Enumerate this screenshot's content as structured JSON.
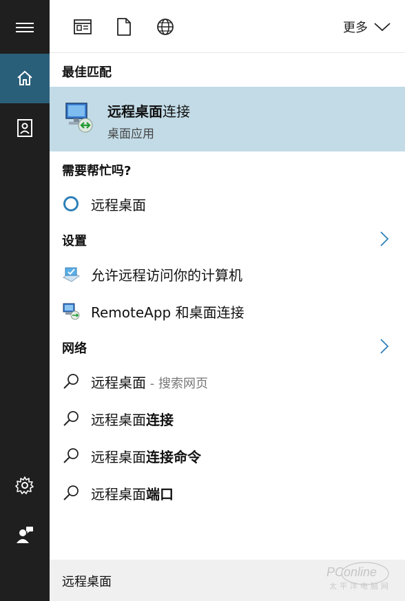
{
  "top_bar": {
    "more_label": "更多"
  },
  "best_match": {
    "heading": "最佳匹配",
    "title_bold": "远程桌面",
    "title_rest": "连接",
    "subtitle": "桌面应用"
  },
  "help": {
    "heading": "需要帮忙吗?",
    "item_label": "远程桌面"
  },
  "settings": {
    "heading": "设置",
    "items": [
      {
        "label": "允许远程访问你的计算机"
      },
      {
        "label": "RemoteApp 和桌面连接"
      }
    ]
  },
  "web": {
    "heading": "网络",
    "items": [
      {
        "prefix": "远程桌面",
        "bold": "",
        "suffix": " - 搜索网页"
      },
      {
        "prefix": "远程桌面",
        "bold": "连接",
        "suffix": ""
      },
      {
        "prefix": "远程桌面",
        "bold": "连接命令",
        "suffix": ""
      },
      {
        "prefix": "远程桌面",
        "bold": "端口",
        "suffix": ""
      }
    ]
  },
  "search_box": {
    "query": "远程桌面"
  },
  "watermark": {
    "brand": "PConline",
    "tagline": "太平洋电脑网"
  },
  "colors": {
    "rail_bg": "#1f1f1f",
    "rail_active": "#2a5f7a",
    "best_match_bg": "#c2dbe6",
    "accent": "#2d7fb8"
  }
}
